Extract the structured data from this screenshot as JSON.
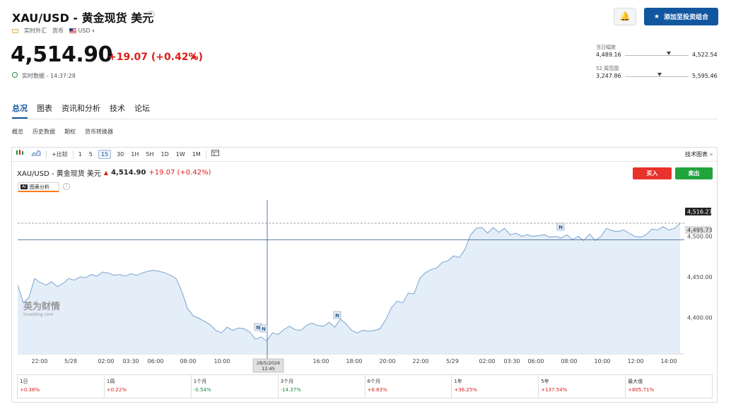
{
  "header": {
    "title": "XAU/USD - 黄金现货 美元",
    "meta_type": "实时外汇",
    "meta_currency_label": "货币",
    "meta_currency": "USD",
    "price": "4,514.90",
    "change": "+19.07 (+0.42%)",
    "realtime": "实时数据 - 14:37:28",
    "add_portfolio": "添加至投资组合"
  },
  "ranges": {
    "day_label": "当日幅度",
    "day_low": "4,489.16",
    "day_high": "4,522.54",
    "day_fraction": 0.69,
    "week52_label": "52 周范围",
    "week52_low": "3,247.86",
    "week52_high": "5,595.46",
    "week52_fraction": 0.54
  },
  "tabs": [
    "总况",
    "图表",
    "资讯和分析",
    "技术",
    "论坛"
  ],
  "subtabs": [
    "概览",
    "历史数据",
    "期权",
    "货币转换器"
  ],
  "toolbar": {
    "compare": "比较",
    "intervals": [
      "1",
      "5",
      "15",
      "30",
      "1H",
      "5H",
      "1D",
      "1W",
      "1M"
    ],
    "active_interval": "15",
    "tech_chart": "技术图表"
  },
  "chart_legend": {
    "name": "XAU/USD - 黄金现货 美元",
    "price": "4,514.90",
    "change": "+19.07 (+0.42%)",
    "ai_badge": "AI",
    "ai_label": "图表分析",
    "buy": "买入",
    "sell": "卖出",
    "watermark_cn": "英为财情",
    "watermark_en": "Investing.com"
  },
  "chart_data": {
    "type": "area",
    "x_ticks": [
      "22:00",
      "5/28",
      "02:00",
      "03:30",
      "06:00",
      "08:00",
      "10:00",
      "14:00",
      "16:00",
      "18:00",
      "20:00",
      "22:00",
      "5/29",
      "02:00",
      "03:30",
      "06:00",
      "08:00",
      "10:00",
      "12:00",
      "14:00"
    ],
    "y_ticks": [
      4400,
      4450,
      4500
    ],
    "y_tick_labels": [
      "4,400.00",
      "4,450.00",
      "4,500.00"
    ],
    "ylim": [
      4355,
      4545
    ],
    "current_label": "4,516.27",
    "current_value": 4516.27,
    "crosshair_value_label": "4,495.73",
    "crosshair_value": 4495.73,
    "crosshair_time": "28/5/2026",
    "crosshair_time2": "12:45",
    "marker_label": "N",
    "values": [
      4440,
      4418,
      4425,
      4448,
      4443,
      4440,
      4444,
      4438,
      4442,
      4448,
      4446,
      4450,
      4449,
      4453,
      4451,
      4456,
      4455,
      4452,
      4453,
      4451,
      4454,
      4452,
      4455,
      4457,
      4458,
      4457,
      4455,
      4452,
      4448,
      4432,
      4411,
      4402,
      4399,
      4395,
      4391,
      4384,
      4381,
      4388,
      4384,
      4387,
      4386,
      4382,
      4373,
      4376,
      4371,
      4381,
      4379,
      4385,
      4389,
      4385,
      4384,
      4390,
      4393,
      4390,
      4389,
      4394,
      4388,
      4398,
      4392,
      4384,
      4381,
      4384,
      4383,
      4384,
      4386,
      4397,
      4412,
      4420,
      4418,
      4430,
      4429,
      4448,
      4455,
      4459,
      4461,
      4468,
      4470,
      4476,
      4474,
      4484,
      4502,
      4510,
      4511,
      4504,
      4511,
      4505,
      4510,
      4502,
      4504,
      4500,
      4502,
      4500,
      4501,
      4502,
      4499,
      4500,
      4498,
      4502,
      4496,
      4500,
      4495,
      4503,
      4495,
      4500,
      4510,
      4507,
      4506,
      4508,
      4504,
      4500,
      4499,
      4502,
      4509,
      4508,
      4512,
      4508,
      4510,
      4516
    ]
  },
  "performance": [
    {
      "label": "1日",
      "value": "+0.38%",
      "dir": "pos"
    },
    {
      "label": "1周",
      "value": "+0.22%",
      "dir": "pos"
    },
    {
      "label": "1个月",
      "value": "-0.54%",
      "dir": "neg"
    },
    {
      "label": "3个月",
      "value": "-14.37%",
      "dir": "neg"
    },
    {
      "label": "6个月",
      "value": "+6.83%",
      "dir": "pos"
    },
    {
      "label": "1年",
      "value": "+36.25%",
      "dir": "pos"
    },
    {
      "label": "5年",
      "value": "+137.54%",
      "dir": "pos"
    },
    {
      "label": "最大值",
      "value": "+805.71%",
      "dir": "pos"
    }
  ]
}
